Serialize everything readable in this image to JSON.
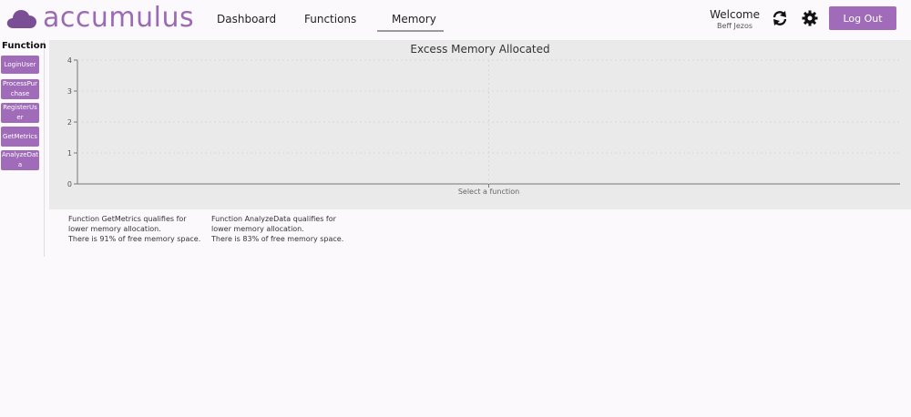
{
  "app": {
    "name": "accumulus"
  },
  "nav": {
    "items": [
      "Dashboard",
      "Functions",
      "Memory"
    ],
    "active": "Memory"
  },
  "user": {
    "welcome": "Welcome",
    "name": "Beff Jezos"
  },
  "header": {
    "logout_label": "Log Out",
    "refresh_icon": "refresh-icon",
    "settings_icon": "gear-icon"
  },
  "sidebar": {
    "title": "Function",
    "items": [
      "LoginUser",
      "ProcessPurchase",
      "RegisterUser",
      "GetMetrics",
      "AnalyzeData"
    ]
  },
  "colors": {
    "accent": "#a06cb9",
    "logo": "#9a6bb5",
    "panel": "#eaeaea"
  },
  "chart_data": {
    "type": "bar",
    "title": "Excess Memory Allocated",
    "xlabel": "Select a function",
    "ylabel": "",
    "categories": [],
    "values": [],
    "ylim": [
      0,
      4
    ],
    "yticks": [
      "0",
      "1",
      "2",
      "3",
      "4"
    ],
    "grid": true
  },
  "notes": [
    {
      "line1": "Function GetMetrics qualifies for",
      "line2": "lower memory allocation.",
      "line3": "There is 91% of free memory space."
    },
    {
      "line1": "Function AnalyzeData qualifies for",
      "line2": "lower memory allocation.",
      "line3": "There is 83% of free memory space."
    }
  ]
}
